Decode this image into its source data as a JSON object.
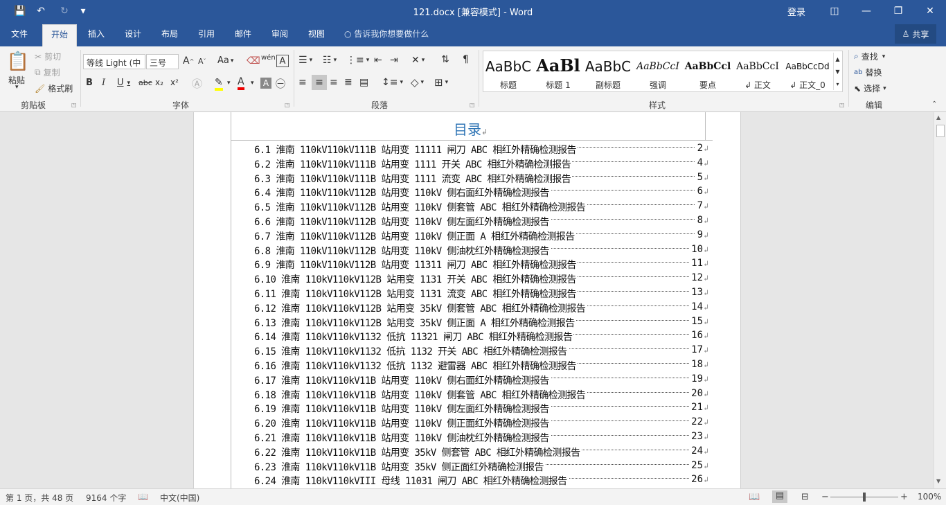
{
  "window": {
    "title": "121.docx [兼容模式]  -  Word",
    "login": "登录",
    "icons": {
      "save": "💾",
      "undo": "↶",
      "redo": "↻",
      "customize": "▾",
      "ribbon_opts": "◫",
      "minimize": "—",
      "restore": "❐",
      "close": "✕"
    }
  },
  "tabs": [
    {
      "label": "文件"
    },
    {
      "label": "开始"
    },
    {
      "label": "插入"
    },
    {
      "label": "设计"
    },
    {
      "label": "布局"
    },
    {
      "label": "引用"
    },
    {
      "label": "邮件"
    },
    {
      "label": "审阅"
    },
    {
      "label": "视图"
    },
    {
      "label": "告诉我你想要做什么"
    }
  ],
  "share_label": "共享",
  "clipboard": {
    "paste": "粘贴",
    "cut": "剪切",
    "copy": "复制",
    "format_painter": "格式刷",
    "group": "剪贴板"
  },
  "font": {
    "name": "等线 Light (中",
    "size": "三号",
    "grow": "A",
    "shrink": "A",
    "case": "Aa",
    "bold": "B",
    "italic": "I",
    "underline": "U",
    "strike": "abc",
    "sub": "x₂",
    "sup": "x²",
    "group": "字体"
  },
  "paragraph": {
    "group": "段落"
  },
  "styles": {
    "items": [
      {
        "preview": "AaBbC",
        "name": "标题"
      },
      {
        "preview": "AaBl",
        "name": "标题 1"
      },
      {
        "preview": "AaBbC",
        "name": "副标题"
      },
      {
        "preview": "AaBbCcI",
        "name": "强调"
      },
      {
        "preview": "AaBbCcl",
        "name": "要点"
      },
      {
        "preview": "AaBbCcI",
        "name": "↲ 正文"
      },
      {
        "preview": "AaBbCcDd",
        "name": "↲ 正文_0"
      }
    ],
    "group": "样式"
  },
  "editing": {
    "find": "查找",
    "replace": "替换",
    "select": "选择",
    "group": "编辑"
  },
  "document": {
    "heading": "目录",
    "toc": [
      {
        "text": "6.1 淮南 110kV110kV111B 站用变 11111 闸刀 ABC 相红外精确检测报告",
        "page": "2"
      },
      {
        "text": "6.2 淮南 110kV110kV111B 站用变 1111 开关 ABC 相红外精确检测报告",
        "page": "4"
      },
      {
        "text": "6.3 淮南 110kV110kV111B 站用变 1111 流变 ABC 相红外精确检测报告",
        "page": "5"
      },
      {
        "text": "6.4 淮南 110kV110kV112B 站用变 110kV 侧右面红外精确检测报告",
        "page": "6"
      },
      {
        "text": "6.5 淮南 110kV110kV112B 站用变 110kV 侧套管 ABC 相红外精确检测报告",
        "page": "7"
      },
      {
        "text": "6.6 淮南 110kV110kV112B 站用变 110kV 侧左面红外精确检测报告",
        "page": "8"
      },
      {
        "text": "6.7 淮南 110kV110kV112B 站用变 110kV 侧正面 A 相红外精确检测报告",
        "page": "9"
      },
      {
        "text": "6.8 淮南 110kV110kV112B 站用变 110kV 侧油枕红外精确检测报告",
        "page": "10"
      },
      {
        "text": "6.9 淮南 110kV110kV112B 站用变 11311 闸刀 ABC 相红外精确检测报告",
        "page": "11"
      },
      {
        "text": "6.10 淮南 110kV110kV112B 站用变 1131 开关 ABC 相红外精确检测报告",
        "page": "12"
      },
      {
        "text": "6.11 淮南 110kV110kV112B 站用变 1131 流变 ABC 相红外精确检测报告",
        "page": "13"
      },
      {
        "text": "6.12 淮南 110kV110kV112B 站用变 35kV 侧套管 ABC 相红外精确检测报告",
        "page": "14"
      },
      {
        "text": "6.13 淮南 110kV110kV112B 站用变 35kV 侧正面 A 相红外精确检测报告",
        "page": "15"
      },
      {
        "text": "6.14 淮南 110kV110kV1132 低抗 11321 闸刀 ABC 相红外精确检测报告",
        "page": "16"
      },
      {
        "text": "6.15 淮南 110kV110kV1132 低抗 1132 开关 ABC 相红外精确检测报告",
        "page": "17"
      },
      {
        "text": "6.16 淮南 110kV110kV1132 低抗 1132 避雷器 ABC 相红外精确检测报告",
        "page": "18"
      },
      {
        "text": "6.17 淮南 110kV110kV11B 站用变 110kV 侧右面红外精确检测报告",
        "page": "19"
      },
      {
        "text": "6.18 淮南 110kV110kV11B 站用变 110kV 侧套管 ABC 相红外精确检测报告",
        "page": "20"
      },
      {
        "text": "6.19 淮南 110kV110kV11B 站用变 110kV 侧左面红外精确检测报告",
        "page": "21"
      },
      {
        "text": "6.20 淮南 110kV110kV11B 站用变 110kV 侧正面红外精确检测报告",
        "page": "22"
      },
      {
        "text": "6.21 淮南 110kV110kV11B 站用变 110kV 侧油枕红外精确检测报告",
        "page": "23"
      },
      {
        "text": "6.22 淮南 110kV110kV11B 站用变 35kV 侧套管 ABC 相红外精确检测报告",
        "page": "24"
      },
      {
        "text": "6.23 淮南 110kV110kV11B 站用变 35kV 侧正面红外精确检测报告",
        "page": "25"
      },
      {
        "text": "6.24 淮南 110kV110kVIII 母线 11031 闸刀 ABC 相红外精确检测报告",
        "page": "26"
      }
    ]
  },
  "status": {
    "page": "第 1 页，共 48 页",
    "words": "9164 个字",
    "lang": "中文(中国)",
    "zoom": "100%",
    "zoom_level": 1.0
  },
  "colors": {
    "brand": "#2b579a",
    "heading": "#2e74b5"
  }
}
